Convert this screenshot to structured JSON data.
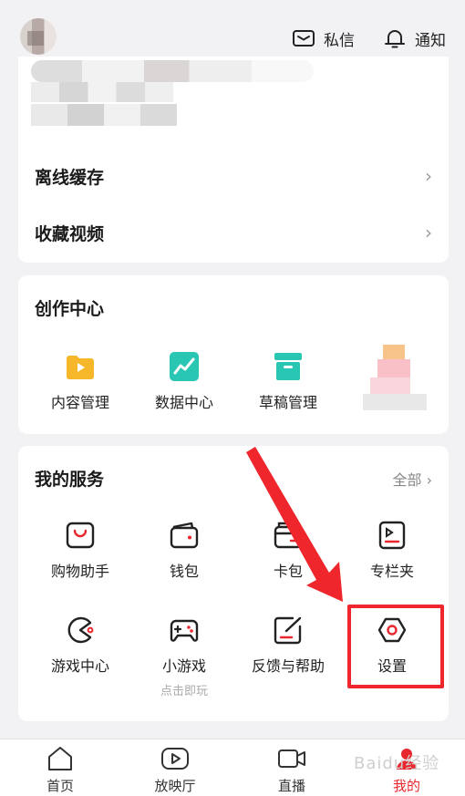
{
  "topbar": {
    "messages_label": "私信",
    "notify_label": "通知"
  },
  "profile_rows": [
    {
      "label": "离线缓存",
      "chevron": "›"
    },
    {
      "label": "收藏视频",
      "chevron": "›"
    }
  ],
  "creation_center": {
    "title": "创作中心",
    "items": [
      {
        "label": "内容管理",
        "icon": "folder-play-icon",
        "color": "#f7b72a"
      },
      {
        "label": "数据中心",
        "icon": "chart-line-icon",
        "color": "#2ac6b4"
      },
      {
        "label": "草稿管理",
        "icon": "archive-box-icon",
        "color": "#2ac6b4"
      }
    ]
  },
  "my_services": {
    "title": "我的服务",
    "all_label": "全部 ›",
    "items": [
      {
        "label": "购物助手",
        "icon": "shopping-bag-icon"
      },
      {
        "label": "钱包",
        "icon": "wallet-icon"
      },
      {
        "label": "卡包",
        "icon": "card-holder-icon"
      },
      {
        "label": "专栏夹",
        "icon": "column-folder-icon"
      },
      {
        "label": "游戏中心",
        "icon": "pacman-game-icon"
      },
      {
        "label": "小游戏",
        "sublabel": "点击即玩",
        "icon": "gamepad-icon"
      },
      {
        "label": "反馈与帮助",
        "icon": "feedback-edit-icon"
      },
      {
        "label": "设置",
        "icon": "settings-hexagon-icon"
      }
    ]
  },
  "tabbar": {
    "tabs": [
      {
        "label": "首页",
        "icon": "home-icon"
      },
      {
        "label": "放映厅",
        "icon": "play-screen-icon"
      },
      {
        "label": "直播",
        "icon": "live-camera-icon"
      },
      {
        "label": "我的",
        "icon": "profile-icon",
        "active": true
      }
    ]
  },
  "watermark": "Baidu经验",
  "colors": {
    "accent_red": "#e8272e",
    "highlight_red": "#f0262d",
    "teal": "#2ac6b4",
    "yellow": "#f7b72a"
  }
}
